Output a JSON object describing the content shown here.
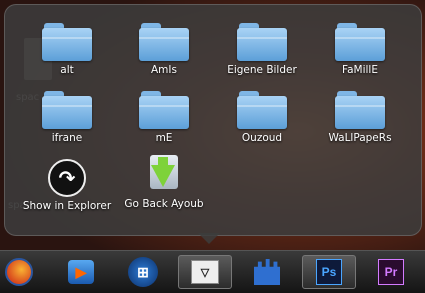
{
  "desktop": {
    "labels": [
      "spac",
      "spac"
    ]
  },
  "stack": {
    "folders": [
      {
        "label": "alt",
        "icon": "folder-icon"
      },
      {
        "label": "AmIs",
        "icon": "folder-icon"
      },
      {
        "label": "Eigene Bilder",
        "icon": "folder-icon"
      },
      {
        "label": "FaMillE",
        "icon": "folder-icon"
      },
      {
        "label": "ifrane",
        "icon": "folder-icon"
      },
      {
        "label": "mE",
        "icon": "folder-icon"
      },
      {
        "label": "Ouzoud",
        "icon": "folder-icon"
      },
      {
        "label": "WaLlPapeRs",
        "icon": "folder-icon"
      }
    ],
    "actions": [
      {
        "label": "Show in Explorer",
        "icon": "curved-arrow-icon"
      },
      {
        "label": "Go Back Ayoub",
        "icon": "go-back-arrow-icon"
      }
    ]
  },
  "taskbar": {
    "items": [
      {
        "name": "firefox",
        "icon": "firefox-icon"
      },
      {
        "name": "windows-media-player",
        "icon": "media-player-icon"
      },
      {
        "name": "start",
        "icon": "windows-orb-icon",
        "glyph": "⊞"
      },
      {
        "name": "stack-dropdown",
        "icon": "chevron-down-icon",
        "glyph": "▽"
      },
      {
        "name": "castle-app",
        "icon": "castle-icon"
      },
      {
        "name": "photoshop",
        "icon": "photoshop-icon",
        "glyph": "Ps"
      },
      {
        "name": "premiere",
        "icon": "premiere-icon",
        "glyph": "Pr"
      }
    ]
  },
  "colors": {
    "folder": "#5c9fd8",
    "popup_bg": "#3c3c3c",
    "taskbar_bg": "#1a1a1a"
  }
}
